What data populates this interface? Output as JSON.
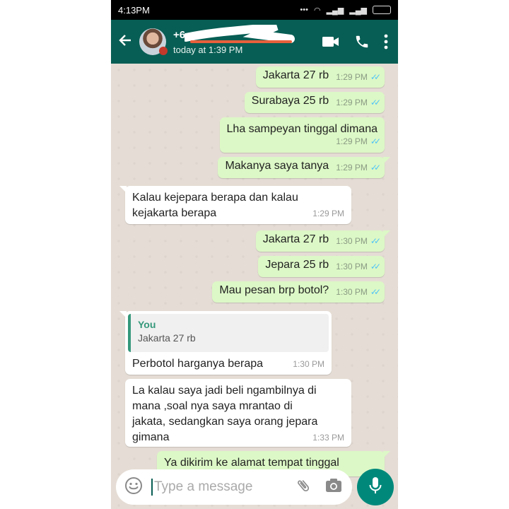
{
  "status_bar": {
    "time": "4:13PM"
  },
  "header": {
    "contact_name": "+6",
    "last_seen": "today at 1:39 PM"
  },
  "messages": [
    {
      "direction": "out",
      "text": "Jakarta 27 rb",
      "time": "1:29 PM",
      "read": true
    },
    {
      "direction": "out",
      "text": "Surabaya 25 rb",
      "time": "1:29 PM",
      "read": true
    },
    {
      "direction": "out",
      "text": "Lha sampeyan tinggal dimana",
      "time": "1:29 PM",
      "read": true
    },
    {
      "direction": "out",
      "text": "Makanya saya tanya",
      "time": "1:29 PM",
      "read": true
    },
    {
      "direction": "in",
      "text_lines": [
        "Kalau kejepara berapa dan kalau",
        "kejakarta berapa"
      ],
      "time": "1:29 PM"
    },
    {
      "direction": "out",
      "text": "Jakarta 27 rb",
      "time": "1:30 PM",
      "read": true
    },
    {
      "direction": "out",
      "text": "Jepara 25 rb",
      "time": "1:30 PM",
      "read": true
    },
    {
      "direction": "out",
      "text": "Mau pesan brp botol?",
      "time": "1:30 PM",
      "read": true
    },
    {
      "direction": "in",
      "quote": {
        "author": "You",
        "text": "Jakarta 27 rb"
      },
      "text": "Perbotol harganya berapa",
      "time": "1:30 PM"
    },
    {
      "direction": "in",
      "text_lines": [
        "La kalau saya jadi beli ngambilnya di",
        "mana ,soal nya saya mrantao di",
        "jakata, sedangkan saya orang jepara",
        "gimana"
      ],
      "time": "1:33 PM"
    },
    {
      "direction": "out",
      "text": "Ya dikirim ke alamat tempat tinggal"
    }
  ],
  "composer": {
    "placeholder": "Type a message"
  },
  "icons": {
    "back": "arrow-left-icon",
    "video": "video-camera-icon",
    "call": "phone-icon",
    "menu": "more-vert-icon",
    "emoji": "emoji-icon",
    "attach": "paperclip-icon",
    "camera": "camera-icon",
    "mic": "microphone-icon",
    "read": "double-check-icon"
  },
  "colors": {
    "header": "#075e54",
    "outgoing_bubble": "#dcf8c6",
    "incoming_bubble": "#ffffff",
    "chat_background": "#e5ddd5",
    "mic_button": "#00897b",
    "read_tick": "#4fc3f7"
  }
}
